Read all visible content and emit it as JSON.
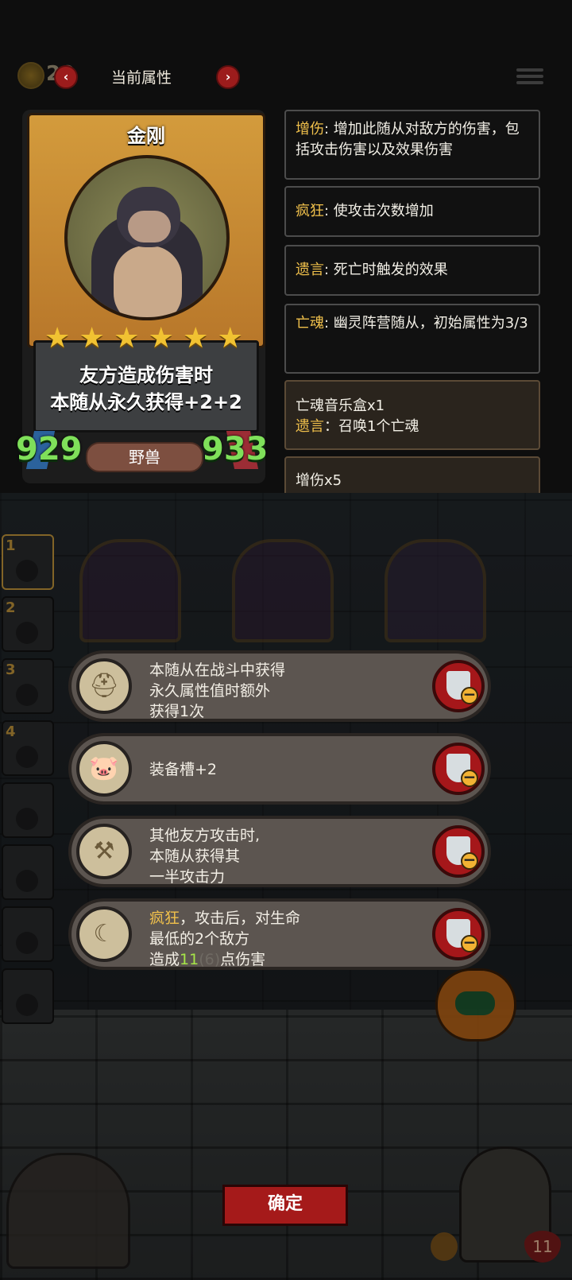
{
  "topbar": {
    "coin_value": "20",
    "title": "当前属性",
    "prev_symbol": "‹",
    "next_symbol": "›"
  },
  "card": {
    "name": "金刚",
    "stars": 6,
    "effect_line1": "友方造成伤害时",
    "effect_line2": "本随从永久获得+2+2",
    "attack": "929",
    "health": "933",
    "tribe": "野兽"
  },
  "keywords": [
    {
      "key": "增伤",
      "sep": ": ",
      "desc": "增加此随从对敌方的伤害，包括攻击伤害以及效果伤害"
    },
    {
      "key": "疯狂",
      "sep": ": ",
      "desc": "使攻击次数增加"
    },
    {
      "key": "遗言",
      "sep": ": ",
      "desc": "死亡时触发的效果"
    },
    {
      "key": "亡魂",
      "sep": ": ",
      "desc": "幽灵阵营随从，初始属性为3/3"
    }
  ],
  "items": [
    {
      "title": "亡魂音乐盒x1",
      "key": "遗言",
      "sep": "：",
      "desc": "召唤1个亡魂"
    },
    {
      "title": "增伤x5"
    }
  ],
  "hero_slots": [
    "1",
    "2",
    "3",
    "4",
    "",
    "",
    "",
    ""
  ],
  "equipment": [
    {
      "icon": "golden-helmet-icon",
      "glyph": "⛑",
      "lines": [
        "本随从在战斗中获得",
        "永久属性值时额外",
        "获得1次"
      ]
    },
    {
      "icon": "pig-mask-icon",
      "glyph": "🐷",
      "lines": [
        "装备槽+2"
      ]
    },
    {
      "icon": "crossed-axes-icon",
      "glyph": "⚒",
      "lines": [
        "其他友方攻击时,",
        "本随从获得其",
        "一半攻击力"
      ]
    },
    {
      "icon": "scythe-icon",
      "glyph": "☾",
      "line1_key": "疯狂",
      "line1_rest": "，攻击后，对生命",
      "line2": "最低的2个敌方",
      "line3_pre": "造成",
      "line3_val": "11",
      "line3_dim": "(6)",
      "line3_post": "点伤害"
    }
  ],
  "confirm_label": "确定",
  "lives": "11",
  "colors": {
    "accent_gold": "#f0c04b",
    "stat_green": "#7fe05a",
    "danger_red": "#a51a1a"
  }
}
